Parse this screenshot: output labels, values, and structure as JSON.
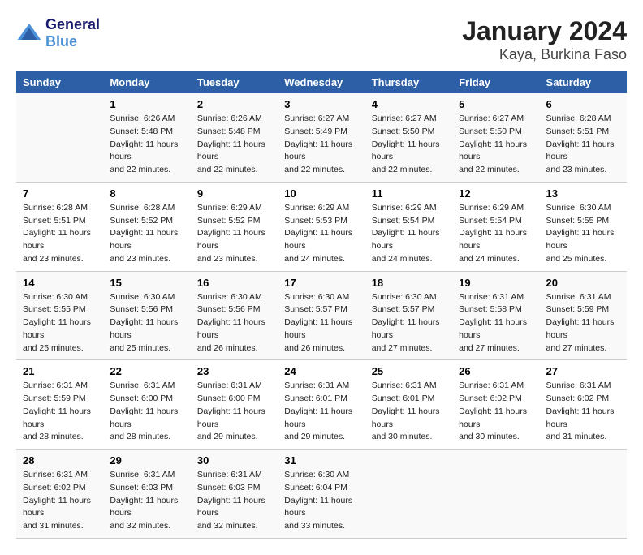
{
  "logo": {
    "line1": "General",
    "line2": "Blue"
  },
  "title": "January 2024",
  "subtitle": "Kaya, Burkina Faso",
  "days_of_week": [
    "Sunday",
    "Monday",
    "Tuesday",
    "Wednesday",
    "Thursday",
    "Friday",
    "Saturday"
  ],
  "weeks": [
    [
      {
        "day": "",
        "sunrise": "",
        "sunset": "",
        "daylight": ""
      },
      {
        "day": "1",
        "sunrise": "Sunrise: 6:26 AM",
        "sunset": "Sunset: 5:48 PM",
        "daylight": "Daylight: 11 hours and 22 minutes."
      },
      {
        "day": "2",
        "sunrise": "Sunrise: 6:26 AM",
        "sunset": "Sunset: 5:48 PM",
        "daylight": "Daylight: 11 hours and 22 minutes."
      },
      {
        "day": "3",
        "sunrise": "Sunrise: 6:27 AM",
        "sunset": "Sunset: 5:49 PM",
        "daylight": "Daylight: 11 hours and 22 minutes."
      },
      {
        "day": "4",
        "sunrise": "Sunrise: 6:27 AM",
        "sunset": "Sunset: 5:50 PM",
        "daylight": "Daylight: 11 hours and 22 minutes."
      },
      {
        "day": "5",
        "sunrise": "Sunrise: 6:27 AM",
        "sunset": "Sunset: 5:50 PM",
        "daylight": "Daylight: 11 hours and 22 minutes."
      },
      {
        "day": "6",
        "sunrise": "Sunrise: 6:28 AM",
        "sunset": "Sunset: 5:51 PM",
        "daylight": "Daylight: 11 hours and 23 minutes."
      }
    ],
    [
      {
        "day": "7",
        "sunrise": "Sunrise: 6:28 AM",
        "sunset": "Sunset: 5:51 PM",
        "daylight": "Daylight: 11 hours and 23 minutes."
      },
      {
        "day": "8",
        "sunrise": "Sunrise: 6:28 AM",
        "sunset": "Sunset: 5:52 PM",
        "daylight": "Daylight: 11 hours and 23 minutes."
      },
      {
        "day": "9",
        "sunrise": "Sunrise: 6:29 AM",
        "sunset": "Sunset: 5:52 PM",
        "daylight": "Daylight: 11 hours and 23 minutes."
      },
      {
        "day": "10",
        "sunrise": "Sunrise: 6:29 AM",
        "sunset": "Sunset: 5:53 PM",
        "daylight": "Daylight: 11 hours and 24 minutes."
      },
      {
        "day": "11",
        "sunrise": "Sunrise: 6:29 AM",
        "sunset": "Sunset: 5:54 PM",
        "daylight": "Daylight: 11 hours and 24 minutes."
      },
      {
        "day": "12",
        "sunrise": "Sunrise: 6:29 AM",
        "sunset": "Sunset: 5:54 PM",
        "daylight": "Daylight: 11 hours and 24 minutes."
      },
      {
        "day": "13",
        "sunrise": "Sunrise: 6:30 AM",
        "sunset": "Sunset: 5:55 PM",
        "daylight": "Daylight: 11 hours and 25 minutes."
      }
    ],
    [
      {
        "day": "14",
        "sunrise": "Sunrise: 6:30 AM",
        "sunset": "Sunset: 5:55 PM",
        "daylight": "Daylight: 11 hours and 25 minutes."
      },
      {
        "day": "15",
        "sunrise": "Sunrise: 6:30 AM",
        "sunset": "Sunset: 5:56 PM",
        "daylight": "Daylight: 11 hours and 25 minutes."
      },
      {
        "day": "16",
        "sunrise": "Sunrise: 6:30 AM",
        "sunset": "Sunset: 5:56 PM",
        "daylight": "Daylight: 11 hours and 26 minutes."
      },
      {
        "day": "17",
        "sunrise": "Sunrise: 6:30 AM",
        "sunset": "Sunset: 5:57 PM",
        "daylight": "Daylight: 11 hours and 26 minutes."
      },
      {
        "day": "18",
        "sunrise": "Sunrise: 6:30 AM",
        "sunset": "Sunset: 5:57 PM",
        "daylight": "Daylight: 11 hours and 27 minutes."
      },
      {
        "day": "19",
        "sunrise": "Sunrise: 6:31 AM",
        "sunset": "Sunset: 5:58 PM",
        "daylight": "Daylight: 11 hours and 27 minutes."
      },
      {
        "day": "20",
        "sunrise": "Sunrise: 6:31 AM",
        "sunset": "Sunset: 5:59 PM",
        "daylight": "Daylight: 11 hours and 27 minutes."
      }
    ],
    [
      {
        "day": "21",
        "sunrise": "Sunrise: 6:31 AM",
        "sunset": "Sunset: 5:59 PM",
        "daylight": "Daylight: 11 hours and 28 minutes."
      },
      {
        "day": "22",
        "sunrise": "Sunrise: 6:31 AM",
        "sunset": "Sunset: 6:00 PM",
        "daylight": "Daylight: 11 hours and 28 minutes."
      },
      {
        "day": "23",
        "sunrise": "Sunrise: 6:31 AM",
        "sunset": "Sunset: 6:00 PM",
        "daylight": "Daylight: 11 hours and 29 minutes."
      },
      {
        "day": "24",
        "sunrise": "Sunrise: 6:31 AM",
        "sunset": "Sunset: 6:01 PM",
        "daylight": "Daylight: 11 hours and 29 minutes."
      },
      {
        "day": "25",
        "sunrise": "Sunrise: 6:31 AM",
        "sunset": "Sunset: 6:01 PM",
        "daylight": "Daylight: 11 hours and 30 minutes."
      },
      {
        "day": "26",
        "sunrise": "Sunrise: 6:31 AM",
        "sunset": "Sunset: 6:02 PM",
        "daylight": "Daylight: 11 hours and 30 minutes."
      },
      {
        "day": "27",
        "sunrise": "Sunrise: 6:31 AM",
        "sunset": "Sunset: 6:02 PM",
        "daylight": "Daylight: 11 hours and 31 minutes."
      }
    ],
    [
      {
        "day": "28",
        "sunrise": "Sunrise: 6:31 AM",
        "sunset": "Sunset: 6:02 PM",
        "daylight": "Daylight: 11 hours and 31 minutes."
      },
      {
        "day": "29",
        "sunrise": "Sunrise: 6:31 AM",
        "sunset": "Sunset: 6:03 PM",
        "daylight": "Daylight: 11 hours and 32 minutes."
      },
      {
        "day": "30",
        "sunrise": "Sunrise: 6:31 AM",
        "sunset": "Sunset: 6:03 PM",
        "daylight": "Daylight: 11 hours and 32 minutes."
      },
      {
        "day": "31",
        "sunrise": "Sunrise: 6:30 AM",
        "sunset": "Sunset: 6:04 PM",
        "daylight": "Daylight: 11 hours and 33 minutes."
      },
      {
        "day": "",
        "sunrise": "",
        "sunset": "",
        "daylight": ""
      },
      {
        "day": "",
        "sunrise": "",
        "sunset": "",
        "daylight": ""
      },
      {
        "day": "",
        "sunrise": "",
        "sunset": "",
        "daylight": ""
      }
    ]
  ]
}
